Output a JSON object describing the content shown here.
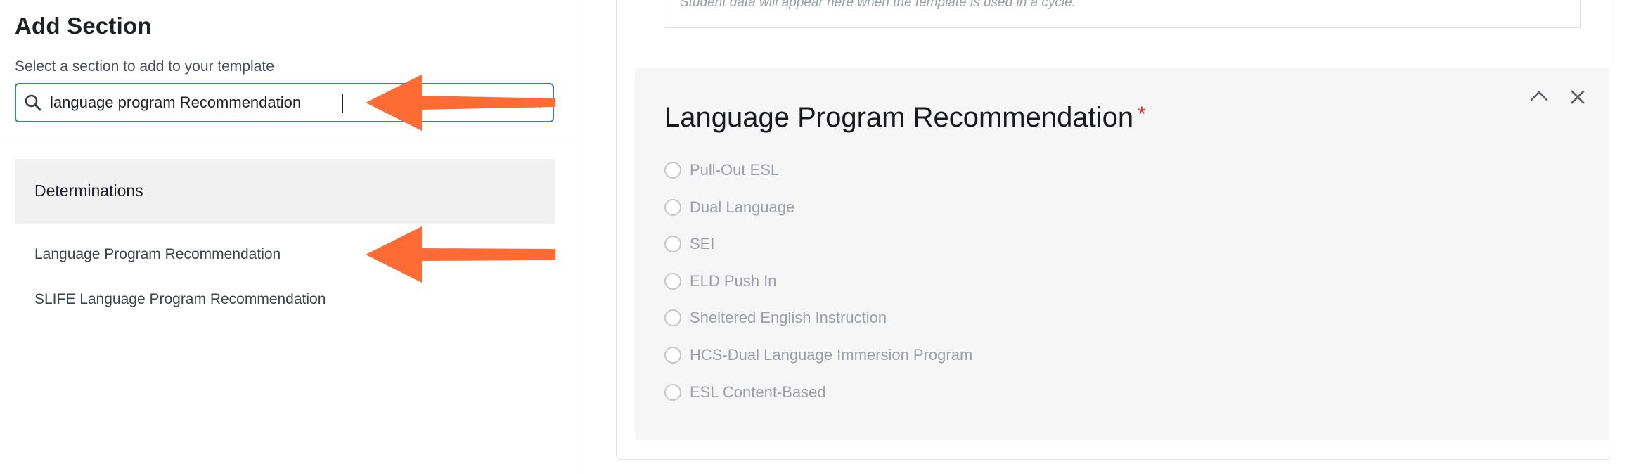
{
  "left_panel": {
    "title": "Add Section",
    "subtitle": "Select a section to add to your template",
    "search": {
      "value": "language program Recommendation",
      "placeholder": ""
    },
    "group": {
      "label": "Determinations"
    },
    "results": [
      {
        "label": "Language Program Recommendation"
      },
      {
        "label": "SLIFE Language Program Recommendation"
      }
    ]
  },
  "right_panel": {
    "student_note": "Student data will appear here when the template is used in a cycle.",
    "section": {
      "title": "Language Program Recommendation",
      "required_marker": "*",
      "options": [
        {
          "label": "Pull-Out ESL"
        },
        {
          "label": "Dual Language"
        },
        {
          "label": "SEI"
        },
        {
          "label": "ELD Push In"
        },
        {
          "label": "Sheltered English Instruction"
        },
        {
          "label": "HCS-Dual Language Immersion Program"
        },
        {
          "label": "ESL Content-Based"
        }
      ]
    }
  },
  "icons": {
    "search": "search-icon",
    "clear": "close-icon",
    "collapse": "chevron-up-icon",
    "close": "close-icon",
    "annotation": "arrow-left-icon"
  },
  "colors": {
    "focus_border": "#3b73d9",
    "arrow": "#ff6b35",
    "required": "#d93025"
  }
}
